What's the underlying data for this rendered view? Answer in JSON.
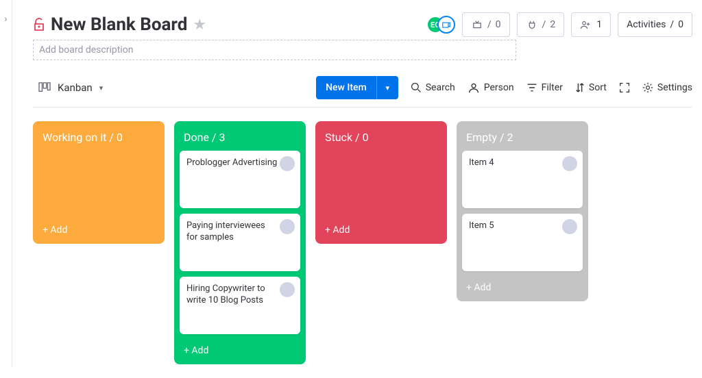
{
  "sidebar": {
    "expand_glyph": "›"
  },
  "header": {
    "title": "New Blank Board",
    "description_placeholder": "Add board description",
    "lock_color": "#e2445c",
    "avatar_initials": "EO",
    "automations": {
      "count": "0"
    },
    "integrations": {
      "count": "2"
    },
    "members": {
      "count": "1"
    },
    "activities": {
      "label": "Activities",
      "count": "0"
    }
  },
  "toolbar": {
    "view_name": "Kanban",
    "new_item_label": "New Item",
    "search_label": "Search",
    "person_label": "Person",
    "filter_label": "Filter",
    "sort_label": "Sort",
    "settings_label": "Settings"
  },
  "columns": [
    {
      "title": "Working on it",
      "count": "0",
      "add_label": "+ Add",
      "color": "col-orange",
      "cards": []
    },
    {
      "title": "Done",
      "count": "3",
      "add_label": "+ Add",
      "color": "col-green",
      "cards": [
        {
          "text": "Problogger Advertising"
        },
        {
          "text": "Paying interviewees for samples"
        },
        {
          "text": "Hiring Copywriter to write 10 Blog Posts"
        }
      ]
    },
    {
      "title": "Stuck",
      "count": "0",
      "add_label": "+ Add",
      "color": "col-red",
      "cards": []
    },
    {
      "title": "Empty",
      "count": "2",
      "add_label": "+ Add",
      "color": "col-grey",
      "cards": [
        {
          "text": "Item 4"
        },
        {
          "text": "Item 5"
        }
      ]
    }
  ]
}
